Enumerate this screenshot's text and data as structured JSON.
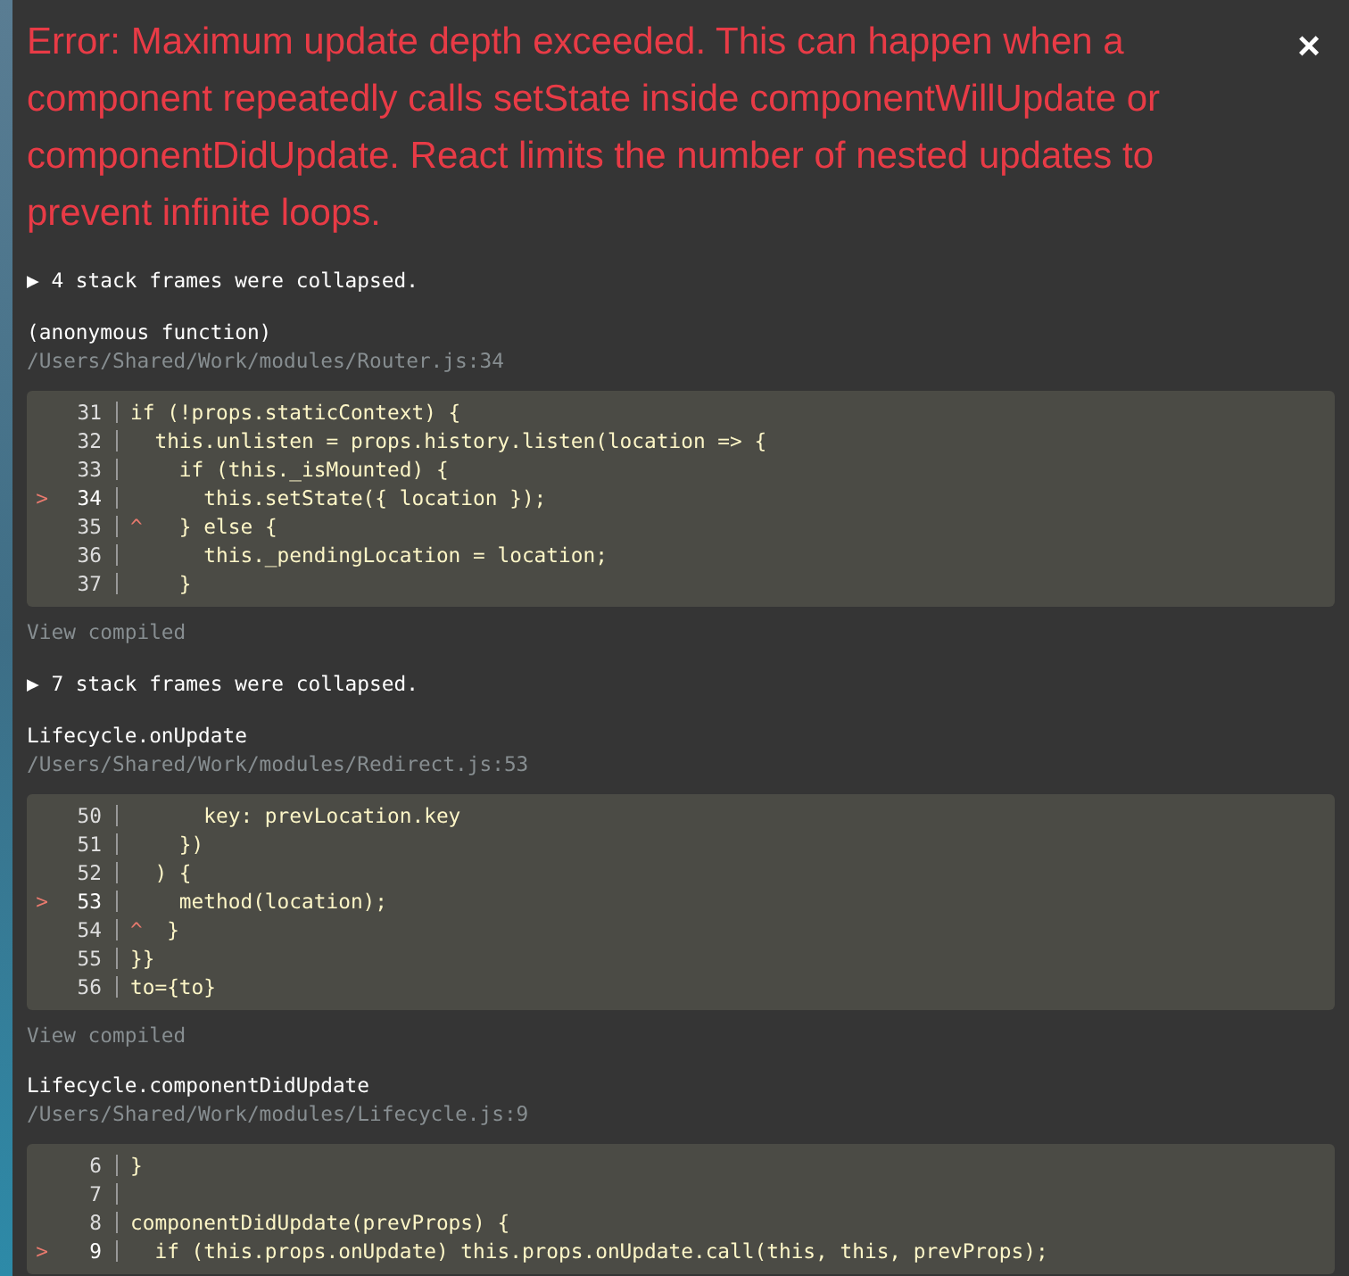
{
  "error": {
    "message": "Error: Maximum update depth exceeded. This can happen when a component repeatedly calls setState inside componentWillUpdate or componentDidUpdate. React limits the number of nested updates to prevent infinite loops.",
    "close": "×"
  },
  "items": [
    {
      "kind": "collapsed",
      "toggle": "▶",
      "text": "4 stack frames were collapsed."
    },
    {
      "kind": "frame",
      "function": "(anonymous function)",
      "file": "/Users/Shared/Work/modules/Router.js:34",
      "lines": [
        {
          "number": "31",
          "code": "if (!props.staticContext) {",
          "highlighted": false
        },
        {
          "number": "32",
          "code": "  this.unlisten = props.history.listen(location => {",
          "highlighted": false
        },
        {
          "number": "33",
          "code": "    if (this._isMounted) {",
          "highlighted": false
        },
        {
          "number": "34",
          "code": "      this.setState({ location });",
          "highlighted": true,
          "marker": ">"
        },
        {
          "number": "35",
          "caret": "^",
          "code": "  } else {",
          "highlighted": false
        },
        {
          "number": "36",
          "code": "      this._pendingLocation = location;",
          "highlighted": false
        },
        {
          "number": "37",
          "code": "    }",
          "highlighted": false
        }
      ],
      "link": "View compiled"
    },
    {
      "kind": "collapsed",
      "toggle": "▶",
      "text": "7 stack frames were collapsed."
    },
    {
      "kind": "frame",
      "function": "Lifecycle.onUpdate",
      "file": "/Users/Shared/Work/modules/Redirect.js:53",
      "lines": [
        {
          "number": "50",
          "code": "      key: prevLocation.key",
          "highlighted": false
        },
        {
          "number": "51",
          "code": "    })",
          "highlighted": false
        },
        {
          "number": "52",
          "code": "  ) {",
          "highlighted": false
        },
        {
          "number": "53",
          "code": "    method(location);",
          "highlighted": true,
          "marker": ">"
        },
        {
          "number": "54",
          "caret": "^",
          "code": " }",
          "highlighted": false
        },
        {
          "number": "55",
          "code": "}}",
          "highlighted": false
        },
        {
          "number": "56",
          "code": "to={to}",
          "highlighted": false
        }
      ],
      "link": "View compiled"
    },
    {
      "kind": "frame",
      "function": "Lifecycle.componentDidUpdate",
      "file": "/Users/Shared/Work/modules/Lifecycle.js:9",
      "lines": [
        {
          "number": "6",
          "code": "}",
          "highlighted": false
        },
        {
          "number": "7",
          "highlighted": false
        },
        {
          "number": "8",
          "code": "componentDidUpdate(prevProps) {",
          "highlighted": false
        },
        {
          "number": "9",
          "code": "  if (this.props.onUpdate) this.props.onUpdate.call(this, this, prevProps);",
          "highlighted": true,
          "marker": ">"
        }
      ]
    }
  ]
}
